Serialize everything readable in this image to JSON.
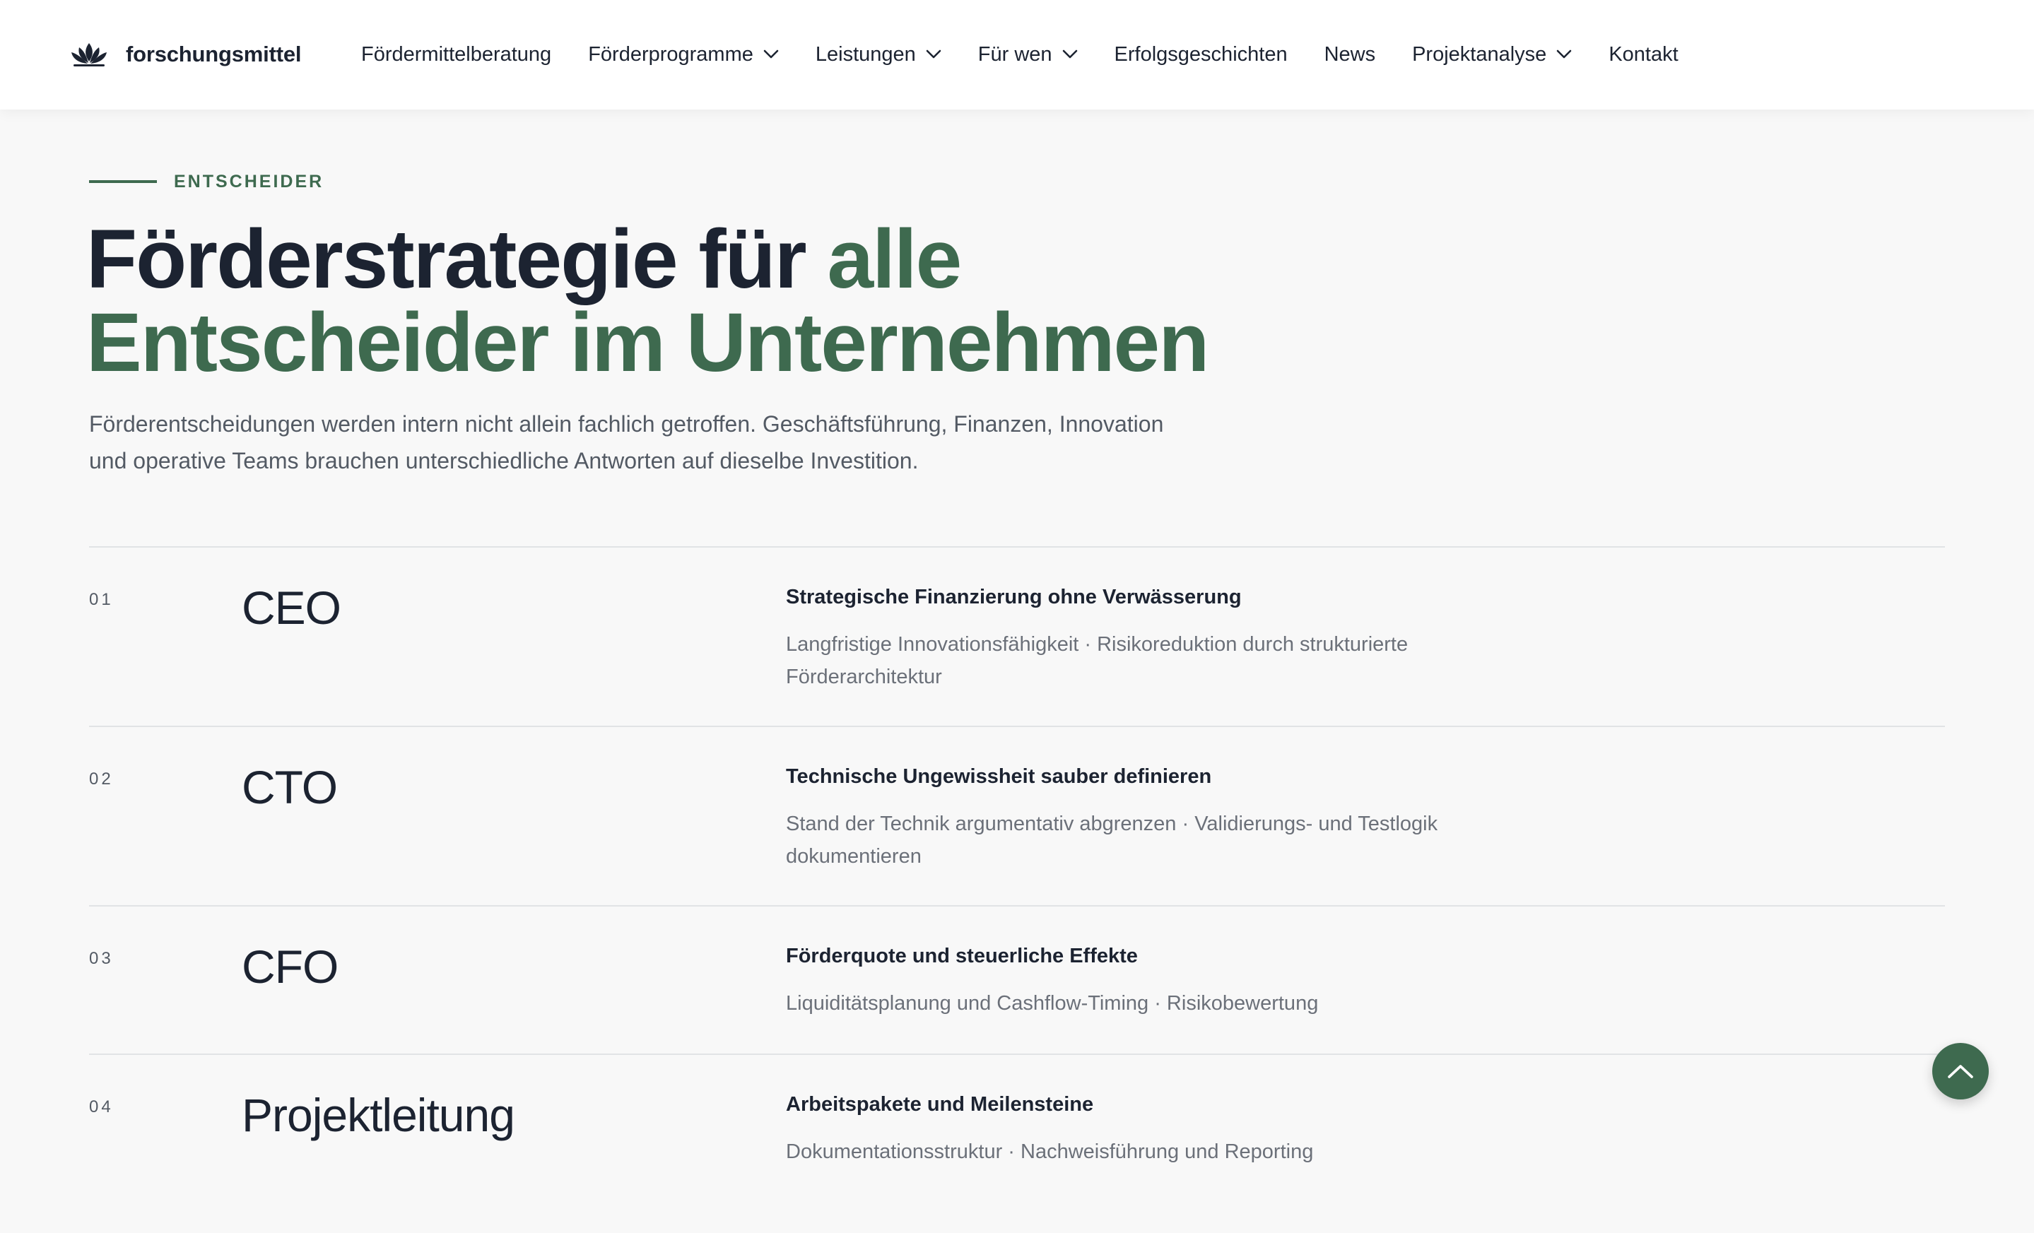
{
  "brand": {
    "name": "forschungsmittel",
    "logo_icon": "lotus-logo-icon"
  },
  "nav": {
    "items": [
      {
        "label": "Fördermittelberatung",
        "has_dropdown": false
      },
      {
        "label": "Förderprogramme",
        "has_dropdown": true
      },
      {
        "label": "Leistungen",
        "has_dropdown": true
      },
      {
        "label": "Für wen",
        "has_dropdown": true
      },
      {
        "label": "Erfolgsgeschichten",
        "has_dropdown": false
      },
      {
        "label": "News",
        "has_dropdown": false
      },
      {
        "label": "Projektanalyse",
        "has_dropdown": true
      },
      {
        "label": "Kontakt",
        "has_dropdown": false
      }
    ],
    "dropdown_icon": "chevron-down-icon"
  },
  "intro": {
    "eyebrow": "ENTSCHEIDER",
    "headline_part1": "Förderstrategie für ",
    "headline_part2": "alle Entscheider im Unternehmen",
    "text": "Förderentscheidungen werden intern nicht allein fachlich getroffen. Geschäftsführung, Finanzen, Innovation und operative Teams brauchen unterschiedliche Antworten auf dieselbe Investition."
  },
  "roles": [
    {
      "number": "01",
      "title": "CEO",
      "heading": "Strategische Finanzierung ohne Verwässerung",
      "description": "Langfristige Innovationsfähigkeit · Risikoreduktion durch strukturierte Förderarchitektur"
    },
    {
      "number": "02",
      "title": "CTO",
      "heading": "Technische Ungewissheit sauber definieren",
      "description": "Stand der Technik argumentativ abgrenzen · Validierungs- und Testlogik dokumentieren"
    },
    {
      "number": "03",
      "title": "CFO",
      "heading": "Förderquote und steuerliche Effekte",
      "description": "Liquiditätsplanung und Cashflow-Timing · Risikobewertung"
    },
    {
      "number": "04",
      "title": "Projektleitung",
      "heading": "Arbeitspakete und Meilensteine",
      "description": "Dokumentationsstruktur · Nachweisführung und Reporting"
    }
  ],
  "scroll_top": {
    "icon": "chevron-up-icon"
  },
  "colors": {
    "accent": "#3e6a4f",
    "text": "#1c2331",
    "muted": "#535a64",
    "background": "#f8f8f8",
    "header": "#ffffff",
    "divider": "#e1e3e5"
  }
}
